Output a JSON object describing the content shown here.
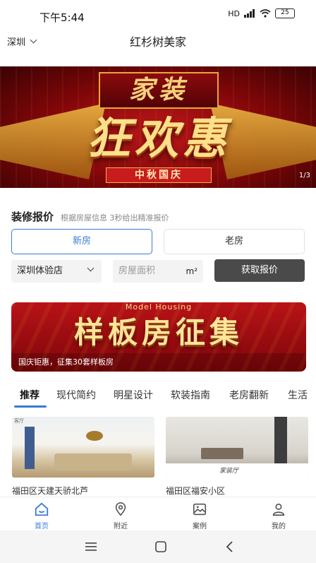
{
  "status_bar": {
    "time": "下午5:44",
    "signal": "HD",
    "battery": "25"
  },
  "header": {
    "city": "深圳",
    "title": "红杉树美家"
  },
  "hero": {
    "top_text": "家装",
    "main_text": "狂欢惠",
    "sub_text": "中秋国庆",
    "page_indicator": "1/3"
  },
  "quote": {
    "title": "装修报价",
    "description": "根据房屋信息 3秒给出精准报价",
    "tabs": [
      "新房",
      "老房"
    ],
    "store": "深圳体验店",
    "area_placeholder": "房屋面积",
    "area_unit": "m²",
    "submit_label": "获取报价"
  },
  "promo": {
    "en_text": "Model Housing",
    "main_text": "样板房征集",
    "caption": "国庆钜惠，征集30套样板房"
  },
  "categories": [
    "推荐",
    "现代简约",
    "明星设计",
    "软装指南",
    "老房翻新",
    "生活"
  ],
  "cards": [
    {
      "title": "福田区天建天骄北芦",
      "image_tag": "客厅"
    },
    {
      "title": "福田区福安小区",
      "image_tag": "家装厅"
    }
  ],
  "nav": [
    "首页",
    "附近",
    "案例",
    "我的"
  ],
  "colors": {
    "accent": "#3a7bd5",
    "dark_button": "#4a4a4a",
    "banner_red": "#b81317"
  }
}
